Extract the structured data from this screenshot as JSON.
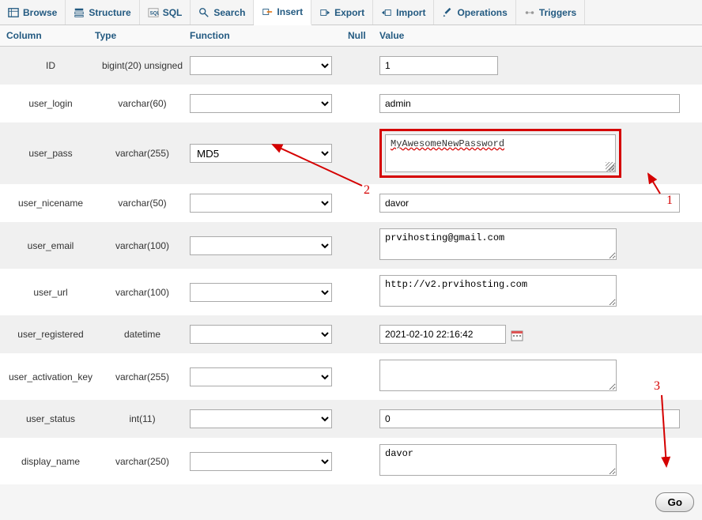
{
  "tabs": [
    {
      "label": "Browse",
      "icon": "browse"
    },
    {
      "label": "Structure",
      "icon": "structure"
    },
    {
      "label": "SQL",
      "icon": "sql"
    },
    {
      "label": "Search",
      "icon": "search"
    },
    {
      "label": "Insert",
      "icon": "insert",
      "active": true
    },
    {
      "label": "Export",
      "icon": "export"
    },
    {
      "label": "Import",
      "icon": "import"
    },
    {
      "label": "Operations",
      "icon": "operations"
    },
    {
      "label": "Triggers",
      "icon": "triggers"
    }
  ],
  "headers": {
    "column": "Column",
    "type": "Type",
    "function": "Function",
    "null": "Null",
    "value": "Value"
  },
  "rows": [
    {
      "column": "ID",
      "type": "bigint(20) unsigned",
      "function": "",
      "value": "1",
      "valueType": "short"
    },
    {
      "column": "user_login",
      "type": "varchar(60)",
      "function": "",
      "value": "admin",
      "valueType": "long"
    },
    {
      "column": "user_pass",
      "type": "varchar(255)",
      "function": "MD5",
      "value": "MyAwesomeNewPassword",
      "valueType": "textarea-red"
    },
    {
      "column": "user_nicename",
      "type": "varchar(50)",
      "function": "",
      "value": "davor",
      "valueType": "long"
    },
    {
      "column": "user_email",
      "type": "varchar(100)",
      "function": "",
      "value": "prvihosting@gmail.com",
      "valueType": "textarea"
    },
    {
      "column": "user_url",
      "type": "varchar(100)",
      "function": "",
      "value": "http://v2.prvihosting.com",
      "valueType": "textarea"
    },
    {
      "column": "user_registered",
      "type": "datetime",
      "function": "",
      "value": "2021-02-10 22:16:42",
      "valueType": "datetime"
    },
    {
      "column": "user_activation_key",
      "type": "varchar(255)",
      "function": "",
      "value": "",
      "valueType": "textarea"
    },
    {
      "column": "user_status",
      "type": "int(11)",
      "function": "",
      "value": "0",
      "valueType": "long"
    },
    {
      "column": "display_name",
      "type": "varchar(250)",
      "function": "",
      "value": "davor",
      "valueType": "textarea"
    }
  ],
  "footer": {
    "go": "Go"
  },
  "annotations": {
    "n1": "1",
    "n2": "2",
    "n3": "3"
  }
}
